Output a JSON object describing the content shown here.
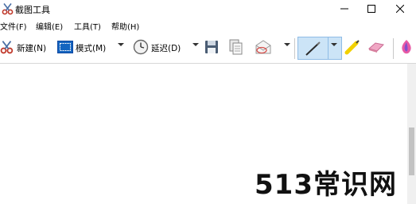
{
  "window": {
    "title": "截图工具",
    "app_icon": "scissors-icon"
  },
  "menu": [
    {
      "label": "文件(F)"
    },
    {
      "label": "编辑(E)"
    },
    {
      "label": "工具(T)"
    },
    {
      "label": "帮助(H)"
    }
  ],
  "toolbar": {
    "new_label": "新建(N)",
    "mode_label": "模式(M)",
    "delay_label": "延迟(D)",
    "icons": {
      "new": "scissors-icon",
      "mode": "mode-icon",
      "delay": "clock-icon",
      "save": "save-icon",
      "copy": "copy-icon",
      "send": "email-icon",
      "pen": "pen-icon",
      "highlighter": "highlighter-icon",
      "eraser": "eraser-icon",
      "paint3d": "paint3d-icon"
    },
    "active_tool": "pen"
  },
  "watermark": {
    "text": "513常识网"
  },
  "colors": {
    "accent": "#cce4f7",
    "accent_border": "#8fbce6",
    "background": "#ffffff"
  }
}
